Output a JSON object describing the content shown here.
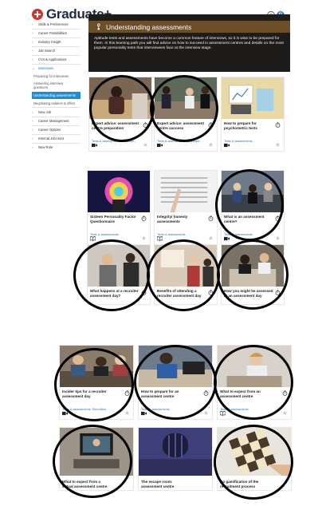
{
  "app": {
    "logo_text": "Graduate+",
    "help_symbol": "?",
    "user_initials": "G"
  },
  "sidebar": {
    "items": [
      {
        "label": "Skills & Preferences",
        "chevron": "›"
      },
      {
        "label": "Career Possibilities",
        "chevron": "›"
      },
      {
        "label": "Industry Insight",
        "chevron": "›"
      },
      {
        "label": "Job Search",
        "chevron": "›"
      },
      {
        "label": "CVs & Applications",
        "chevron": "›"
      },
      {
        "label": "Interviews",
        "chevron": "⌄"
      },
      {
        "label": "Preparing for interviews"
      },
      {
        "label": "Answering interview questions"
      },
      {
        "label": "Understanding assessments"
      },
      {
        "label": "Negotiating salaries & offers"
      },
      {
        "label": "New Job",
        "chevron": "›"
      },
      {
        "label": "Career Management",
        "chevron": "›"
      },
      {
        "label": "Career Options",
        "chevron": "›"
      },
      {
        "label": "Internal Job Hunt",
        "chevron": "›"
      },
      {
        "label": "New Role",
        "chevron": "›"
      }
    ]
  },
  "hero": {
    "title": "Understanding assessments",
    "description": "Aptitude tests and assessments have become a common feature of interviews, so it is wise to be prepared for them. In this learning path you will find advice on how to succeed in assessment centres and details on the most popular personality tests that interviewees face at the interview stage."
  },
  "cards": [
    {
      "title": "Expert advice: assessment centre preparation",
      "tags": "Tests & assessments, Employer...",
      "type": "video-icon"
    },
    {
      "title": "Expert advice: assessment centre success",
      "tags": "Tests & assessments, Employer...",
      "type": "video-icon"
    },
    {
      "title": "How to prepare for psychometric tests",
      "tags": "Tests & assessments",
      "type": "video-icon"
    },
    {
      "title": "Sixteen Personality Factor Questionnaire",
      "tags": "Tests & assessments",
      "type": "book-icon"
    },
    {
      "title": "Integrity/ honesty assessments",
      "tags": "Tests & assessments",
      "type": "book-icon"
    },
    {
      "title": "What is an assessment centre?",
      "tags": "Tests & assessments",
      "type": "video-icon"
    },
    {
      "title": "What happens at a recruiter assessment day?",
      "tags": "",
      "type": ""
    },
    {
      "title": "Benefits of attending a recruiter assessment day",
      "tags": "",
      "type": ""
    },
    {
      "title": "How you might be assessed at an assessment day",
      "tags": "",
      "type": ""
    },
    {
      "title": "Insider tips for a recruiter assessment day",
      "tags": "Tests & assessments, Recruiters",
      "type": "video-icon"
    },
    {
      "title": "How to prepare for an assessment centre",
      "tags": "Tests & assessments",
      "type": "video-icon"
    },
    {
      "title": "What to expect from an assessment centre",
      "tags": "Tests & assessments",
      "type": "book-icon"
    },
    {
      "title": "What to expect from a virtual assessment centre",
      "tags": "",
      "type": ""
    },
    {
      "title": "The escape room: assessment centre",
      "tags": "",
      "type": ""
    },
    {
      "title": "Do gamification of the recruitment process",
      "tags": "",
      "type": ""
    }
  ],
  "colors": {
    "accent": "#1b8fd6",
    "brand_red": "#d0342c",
    "brand_navy": "#1d2a44",
    "hero_band": "#6a4f28",
    "hero_bg": "#1e1c1a",
    "tag_link": "#2a73c0",
    "highlight_ring": "#000000"
  }
}
